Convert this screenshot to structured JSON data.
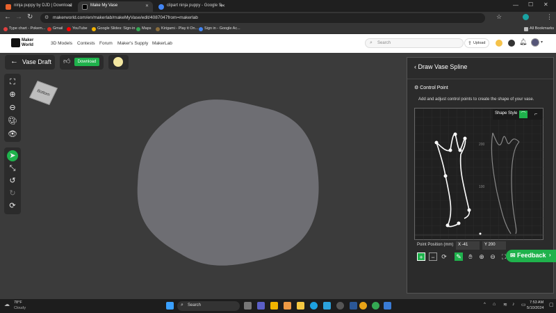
{
  "browser": {
    "tabs": [
      {
        "label": "ninja puppy by DJD | Download",
        "active": false,
        "color": "#e8622c"
      },
      {
        "label": "Make My Vase",
        "active": true,
        "color": "#222"
      },
      {
        "label": "clipart ninja puppy - Google S",
        "active": false,
        "color": "#4285f4"
      }
    ],
    "url": "makerworld.com/en/makerlab/makeMyVase/edit/4087047from=makerlab",
    "bookmarks": [
      {
        "label": "Type chart - Pokem...",
        "color": "#e04040"
      },
      {
        "label": "Gmail",
        "color": "#d93025"
      },
      {
        "label": "YouTube",
        "color": "#ff0000"
      },
      {
        "label": "Google Slides: Sign-in",
        "color": "#f4b400"
      },
      {
        "label": "Maps",
        "color": "#34a853"
      },
      {
        "label": "Kirigami - Play it On...",
        "color": "#8a6d3b"
      },
      {
        "label": "Sign in - Google Ac...",
        "color": "#4285f4"
      }
    ],
    "all_bookmarks": "All Bookmarks"
  },
  "site": {
    "logo": "Maker World",
    "nav": [
      "3D Models",
      "Contests",
      "Forum",
      "Maker's Supply",
      "MakerLab"
    ],
    "search_placeholder": "Search",
    "upload_label": "Upload"
  },
  "toolbar": {
    "back_label": "Vase Draft",
    "download_label": "Download"
  },
  "view_cube_label": "Bottom",
  "panel": {
    "title": "Draw Vase Spline",
    "section": "Control Point",
    "description": "Add and adjust control points to create the shape of your vase.",
    "shape_style_label": "Shape Style",
    "grid_label_200": "200",
    "grid_label_100": "100",
    "point_position_label": "Point Position (mm)",
    "x_value": "X -41",
    "y_value": "Y 200"
  },
  "feedback_label": "Feedback",
  "taskbar": {
    "weather_temp": "78°F",
    "weather_desc": "Cloudy",
    "search_label": "Search",
    "time": "7:53 AM",
    "date": "5/10/2024"
  },
  "colors": {
    "accent": "#1fb24c",
    "vase": "#6e6e73"
  }
}
